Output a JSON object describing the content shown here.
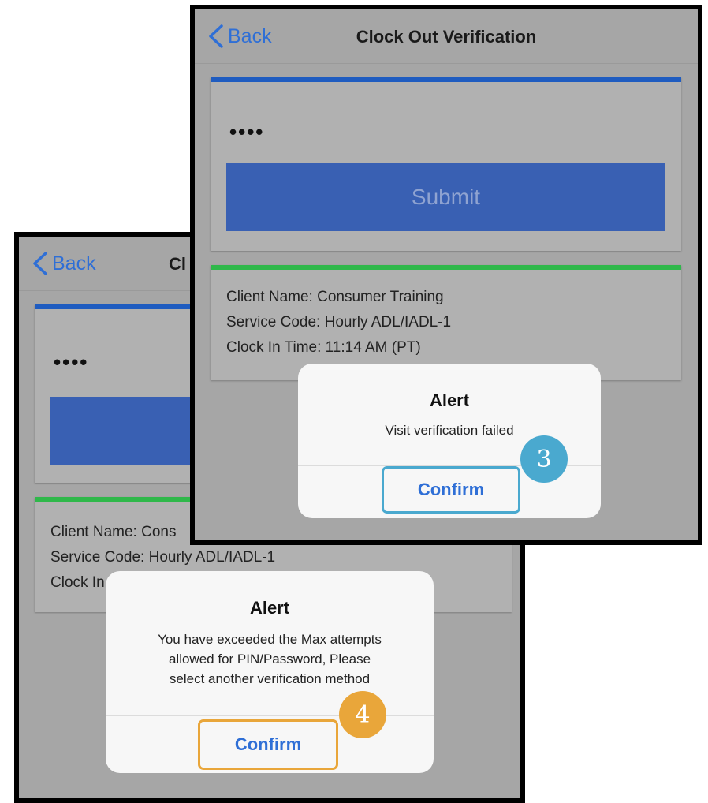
{
  "colors": {
    "ios_blue": "#2f6fd6",
    "submit_blue": "#3960b3",
    "card_top_blue": "#1f5cc0",
    "card_top_green": "#2fb84a",
    "overlay_gray": "#a6a6a6",
    "badge_teal": "#4aa9cf",
    "badge_orange": "#e9a63a"
  },
  "icons": {
    "back": "chevron-left-icon"
  },
  "front_screen": {
    "back_label": "Back",
    "title": "Clock Out Verification",
    "pin_value": "••••",
    "submit_label": "Submit",
    "client_name": "Client Name: Consumer Training",
    "service_code": "Service Code: Hourly ADL/IADL-1",
    "clock_in_time": "Clock In Time: 11:14 AM (PT)",
    "alert": {
      "title": "Alert",
      "message": "Visit verification failed",
      "confirm_label": "Confirm"
    },
    "step_badge": "3"
  },
  "back_screen": {
    "back_label": "Back",
    "title_partial": "Cl",
    "pin_value": "••••",
    "client_name_partial": "Client Name: Cons",
    "service_code": "Service Code: Hourly ADL/IADL-1",
    "clock_in_partial": "Clock In",
    "alert": {
      "title": "Alert",
      "message_lines": [
        "You have exceeded the Max attempts",
        "allowed for PIN/Password, Please",
        "select another verification method"
      ],
      "confirm_label": "Confirm"
    },
    "step_badge": "4"
  }
}
